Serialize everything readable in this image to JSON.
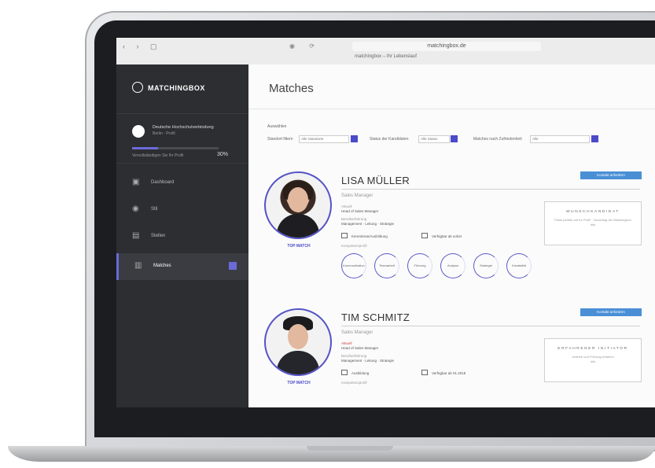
{
  "browser": {
    "nav": "‹ ›  ▢",
    "controls": "◉ ⟳",
    "url": "matchingbox.de",
    "tab_title": "matchingbox – Ihr Lebenslauf"
  },
  "sidebar": {
    "logo": "MATCHINGBOX",
    "profile": {
      "name": "Deutsche Hochschulverbindung",
      "sub": "Berlin · Profil",
      "progress_label": "Vervollständigen Sie Ihr Profil",
      "progress_pct": "30%",
      "progress_value": 0.3
    },
    "items": [
      {
        "label": "Dashboard",
        "icon": "dashboard-icon"
      },
      {
        "label": "Stil",
        "icon": "globe-icon"
      },
      {
        "label": "Stellen",
        "icon": "briefcase-icon"
      },
      {
        "label": "Matches",
        "icon": "document-icon"
      }
    ]
  },
  "main": {
    "title": "Matches",
    "filters": {
      "title": "Auswählen",
      "groups": [
        {
          "label": "Standort filtern",
          "value": "Alle Standorte"
        },
        {
          "label": "Status der Kandidaten",
          "value": "Alle Status"
        },
        {
          "label": "Matches nach Zufriedenheit",
          "value": "Alle"
        }
      ]
    },
    "candidates": [
      {
        "name": "LISA MÜLLER",
        "role": "Sales Manager",
        "match": "TOP MATCH",
        "button": "Kontakt anfordern",
        "detail_label": "Aktuell",
        "detail_value": "Head of Sales Manager",
        "skills_label": "Berufserfahrung",
        "skills": "Management · Leitung · Strategie",
        "meta_left": "Kenntnisse/Ausbildung",
        "meta_right": "Verfügbar ab sofort",
        "competence_label": "Kompetenzprofil",
        "wish_title": "WUNSCHKANDIDAT",
        "wish_desc": "Passt perfekt auf Ihr Profil · Vorschlag der Matchingbox",
        "wish_extra": "Info",
        "rings": [
          "Kommunikation",
          "Teamarbeit",
          "Führung",
          "Analyse",
          "Strategie",
          "Kreativität"
        ]
      },
      {
        "name": "TIM SCHMITZ",
        "role": "Sales Manager",
        "match": "TOP MATCH",
        "button": "Kontakt anfordern",
        "detail_label": "Aktuell",
        "detail_value": "Head of Sales Manager",
        "skills_label": "Berufserfahrung",
        "skills": "Management · Leitung · Strategie",
        "meta_left": "Ausbildung",
        "meta_right": "Verfügbar ab 01.2018",
        "competence_label": "Kompetenzprofil",
        "wish_title": "ERFAHRENER INITIATOR",
        "wish_desc": "Vertrieb und Führung erfahren",
        "wish_extra": "Info"
      }
    ]
  },
  "colors": {
    "accent": "#5453c7",
    "button": "#4a8fd6",
    "sidebar": "#2d2e31"
  }
}
